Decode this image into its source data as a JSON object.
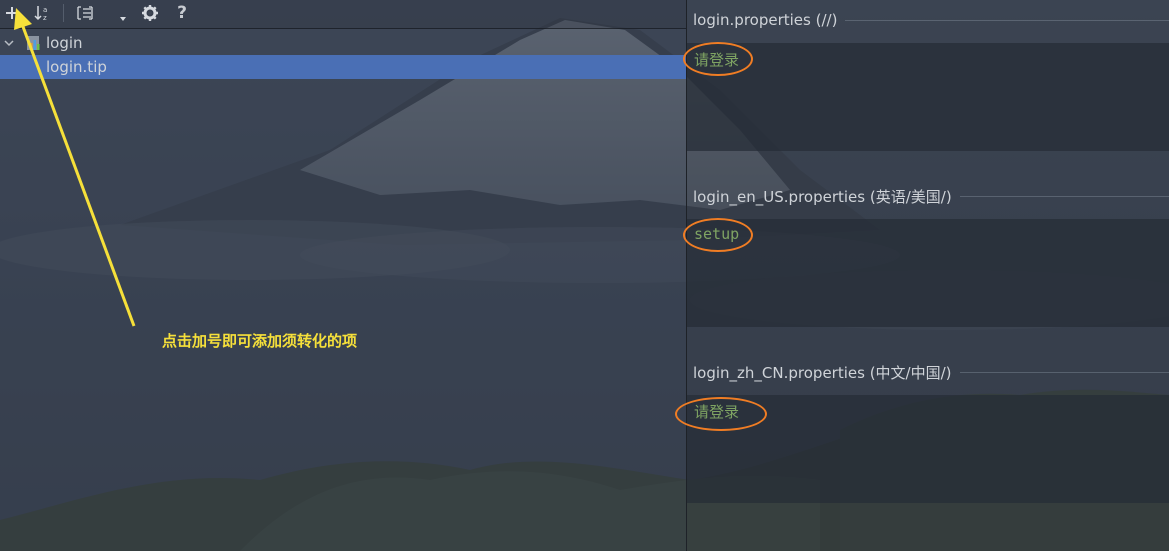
{
  "toolbar": {
    "add_icon": "plus-icon",
    "sort_icon": "sort-alphabetically-icon",
    "group_icon": "group-by-icon",
    "dropdown_icon": "dropdown-arrow-icon",
    "settings_icon": "gear-icon",
    "help_icon": "help-icon"
  },
  "tree": {
    "items": [
      {
        "label": "login",
        "expanded": true,
        "icon": "resource-bundle-icon"
      },
      {
        "label": "login.tip",
        "selected": true
      }
    ]
  },
  "annotation": {
    "text": "点击加号即可添加须转化的项",
    "color": "#f6e03a"
  },
  "editors": [
    {
      "title": "login.properties (//)",
      "value": "请登录"
    },
    {
      "title": "login_en_US.properties (英语/美国/)",
      "value": "setup"
    },
    {
      "title": "login_zh_CN.properties (中文/中国/)",
      "value": "请登录"
    }
  ],
  "colors": {
    "selection": "#4a6fb5",
    "value_text": "#7fa463",
    "highlight_circle": "#f07d24"
  }
}
